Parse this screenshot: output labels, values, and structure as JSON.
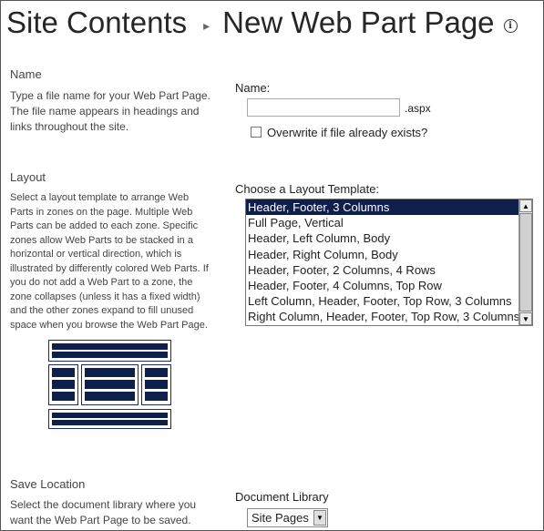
{
  "header": {
    "breadcrumb_root": "Site Contents",
    "page_title": "New Web Part Page"
  },
  "name_section": {
    "heading": "Name",
    "description": "Type a file name for your Web Part Page. The file name appears in headings and links throughout the site.",
    "field_label": "Name:",
    "input_value": "",
    "extension": ".aspx",
    "overwrite_label": "Overwrite if file already exists?",
    "overwrite_checked": false
  },
  "layout_section": {
    "heading": "Layout",
    "description": "Select a layout template to arrange Web Parts in zones on the page. Multiple Web Parts can be added to each zone. Specific zones allow Web Parts to be stacked in a horizontal or vertical direction, which is illustrated by differently colored Web Parts. If you do not add a Web Part to a zone, the zone collapses (unless it has a fixed width) and the other zones expand to fill unused space when you browse the Web Part Page.",
    "field_label": "Choose a Layout Template:",
    "templates": [
      "Header, Footer, 3 Columns",
      "Full Page, Vertical",
      "Header, Left Column, Body",
      "Header, Right Column, Body",
      "Header, Footer, 2 Columns, 4 Rows",
      "Header, Footer, 4 Columns, Top Row",
      "Left Column, Header, Footer, Top Row, 3 Columns",
      "Right Column, Header, Footer, Top Row, 3 Columns"
    ],
    "selected_template": "Header, Footer, 3 Columns"
  },
  "save_section": {
    "heading": "Save Location",
    "description": "Select the document library where you want the Web Part Page to be saved.",
    "field_label": "Document Library",
    "selected_library": "Site Pages"
  },
  "icons": {
    "info": "info-icon",
    "chevron": "chevron-right-icon"
  },
  "colors": {
    "selection": "#0f1f4c",
    "diagram_fill": "#0f1f4c"
  }
}
